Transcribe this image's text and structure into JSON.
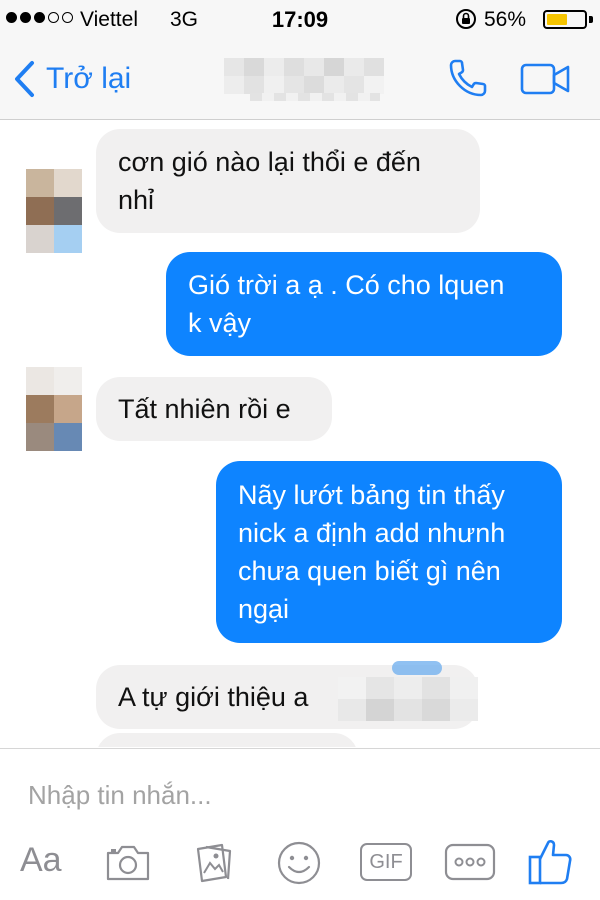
{
  "status_bar": {
    "carrier": "Viettel",
    "network": "3G",
    "time": "17:09",
    "battery_percent": "56%",
    "battery_level": 0.56,
    "signal_bars": 3,
    "signal_total": 5
  },
  "nav": {
    "back_label": "Trở lại",
    "accent_color": "#1f7ef2",
    "phone_icon": "phone-icon",
    "video_icon": "video-camera-icon"
  },
  "messages": [
    {
      "direction": "incoming",
      "lines": [
        "cơn gió nào lại thổi e đến",
        "nhỉ"
      ]
    },
    {
      "direction": "outgoing",
      "lines": [
        "Gió trời a ạ . Có cho lquen",
        "k vậy"
      ]
    },
    {
      "direction": "incoming",
      "lines": [
        "Tất nhiên rồi e"
      ]
    },
    {
      "direction": "outgoing",
      "lines": [
        "Nãy lướt bảng tin thấy",
        "nick a định add nhưnh",
        "chưa quen biết gì nên",
        "ngại"
      ]
    },
    {
      "direction": "incoming",
      "lines": [
        "A tự giới thiệu a"
      ]
    }
  ],
  "bubble_colors": {
    "incoming": "#f1f0f0",
    "outgoing": "#0e84ff"
  },
  "composer": {
    "placeholder": "Nhập tin nhắn...",
    "aa_label": "Aa",
    "gif_label": "GIF",
    "tools": [
      "text-format-icon",
      "camera-icon",
      "photo-gallery-icon",
      "emoji-icon",
      "gif-icon",
      "more-icon",
      "like-icon"
    ]
  }
}
